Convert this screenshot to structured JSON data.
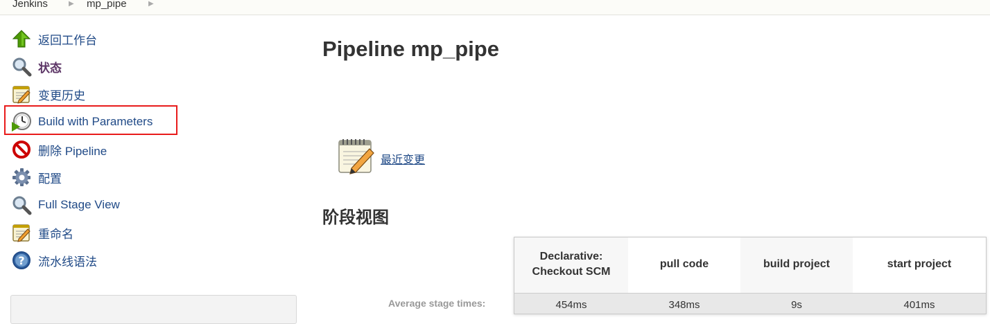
{
  "breadcrumb": [
    {
      "label": "Jenkins"
    },
    {
      "label": "mp_pipe"
    }
  ],
  "sidebar": {
    "items": [
      {
        "label": "返回工作台",
        "icon": "up-arrow-icon"
      },
      {
        "label": "状态",
        "icon": "magnifier-icon"
      },
      {
        "label": "变更历史",
        "icon": "notepad-icon"
      },
      {
        "label": "Build with Parameters",
        "icon": "clock-play-icon"
      },
      {
        "label": "删除 Pipeline",
        "icon": "no-entry-icon"
      },
      {
        "label": "配置",
        "icon": "gear-icon"
      },
      {
        "label": "Full Stage View",
        "icon": "magnifier-icon"
      },
      {
        "label": "重命名",
        "icon": "notepad-icon"
      },
      {
        "label": "流水线语法",
        "icon": "help-icon"
      }
    ]
  },
  "main": {
    "title": "Pipeline mp_pipe",
    "recent_changes_label": "最近变更",
    "stage_view_title": "阶段视图",
    "avg_stage_times_label": "Average stage times:",
    "stages": [
      {
        "name": "Declarative: Checkout SCM",
        "avg_time": "454ms"
      },
      {
        "name": "pull code",
        "avg_time": "348ms"
      },
      {
        "name": "build project",
        "avg_time": "9s"
      },
      {
        "name": "start project",
        "avg_time": "401ms"
      }
    ]
  },
  "colors": {
    "link": "#204a87",
    "highlight_box": "#e81b1b",
    "header_bg": "#fcfcf8"
  }
}
